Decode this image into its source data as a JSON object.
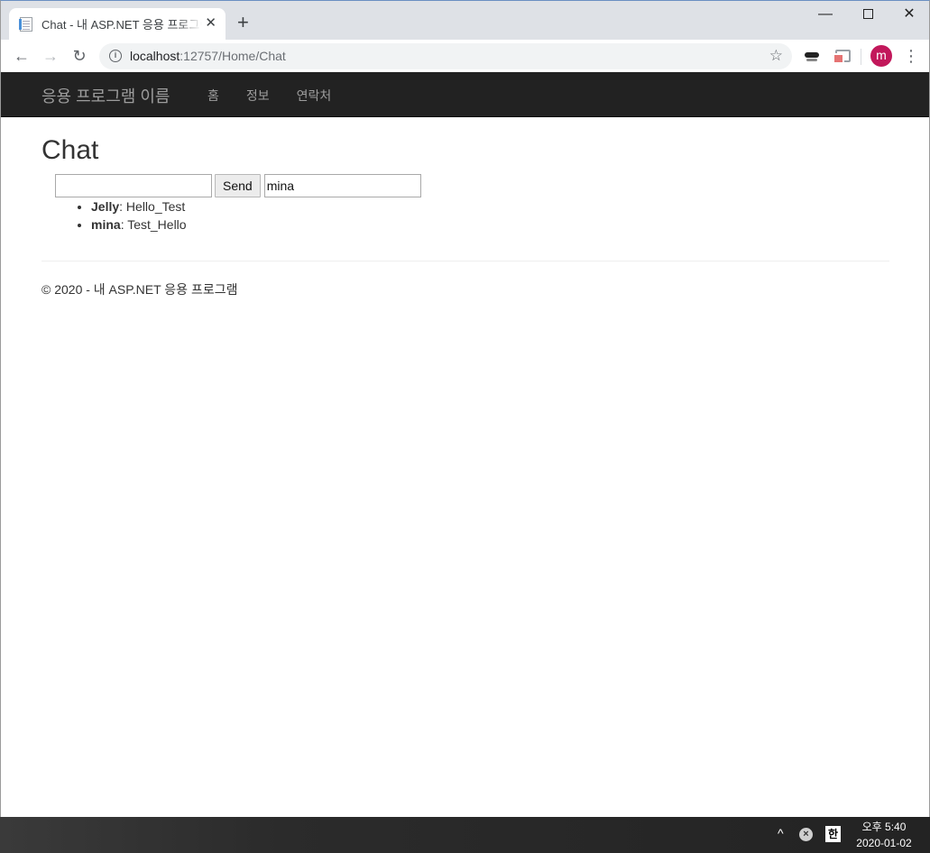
{
  "browser": {
    "tab_title": "Chat - 내 ASP.NET 응용 프로그램",
    "tab_close": "✕",
    "new_tab": "+",
    "window_minimize": "—",
    "window_close": "✕",
    "url_host": "localhost",
    "url_path": ":12757/Home/Chat",
    "back": "←",
    "forward": "→",
    "reload": "↻",
    "info": "i",
    "star": "☆",
    "profile_initial": "m",
    "menu": "⋮"
  },
  "navbar": {
    "brand": "응용 프로그램 이름",
    "links": [
      "홈",
      "정보",
      "연락처"
    ]
  },
  "page": {
    "title": "Chat",
    "message_input_value": "",
    "send_label": "Send",
    "name_input_value": "mina",
    "messages": [
      {
        "user": "Jelly",
        "text": ": Hello_Test"
      },
      {
        "user": "mina",
        "text": ": Test_Hello"
      }
    ],
    "footer": "© 2020 - 내 ASP.NET 응용 프로그램"
  },
  "taskbar": {
    "tray_up": "^",
    "tray_x": "×",
    "ime": "한",
    "time": "오후 5:40",
    "date": "2020-01-02"
  },
  "icons": {
    "tab_favicon": "document-icon",
    "extension_1": "incognito-glasses-icon",
    "extension_2": "cast-icon"
  },
  "colors": {
    "navbar_bg": "#222222",
    "navbar_text": "#9d9d9d",
    "avatar": "#c2185b"
  }
}
